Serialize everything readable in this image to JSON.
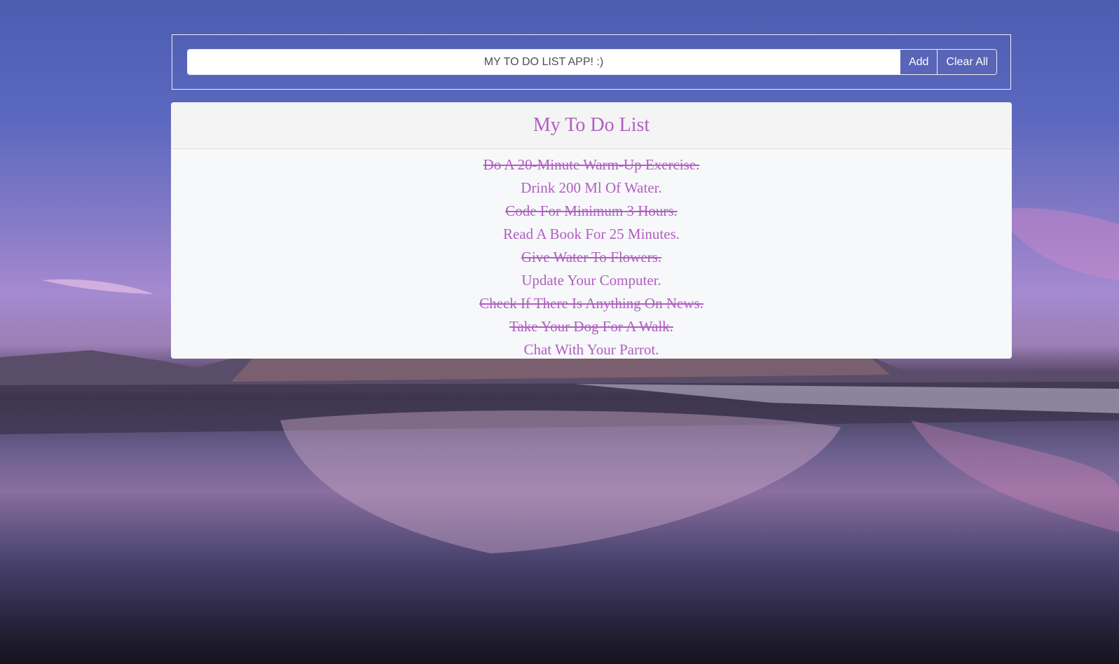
{
  "input": {
    "placeholder": "MY TO DO LIST APP! :)"
  },
  "buttons": {
    "add": "Add",
    "clear_all": "Clear All"
  },
  "card": {
    "title": "My To Do List"
  },
  "todos": [
    {
      "text": "Do A 20-Minute Warm-Up Exercise.",
      "done": true
    },
    {
      "text": "Drink 200 Ml Of Water.",
      "done": false
    },
    {
      "text": "Code For Minimum 3 Hours.",
      "done": true
    },
    {
      "text": "Read A Book For 25 Minutes.",
      "done": false
    },
    {
      "text": "Give Water To Flowers.",
      "done": true
    },
    {
      "text": "Update Your Computer.",
      "done": false
    },
    {
      "text": "Check If There Is Anything On News.",
      "done": true
    },
    {
      "text": "Take Your Dog For A Walk.",
      "done": true
    },
    {
      "text": "Chat With Your Parrot.",
      "done": false
    }
  ],
  "colors": {
    "accent": "#b05fc0",
    "button": "#5965b7"
  }
}
